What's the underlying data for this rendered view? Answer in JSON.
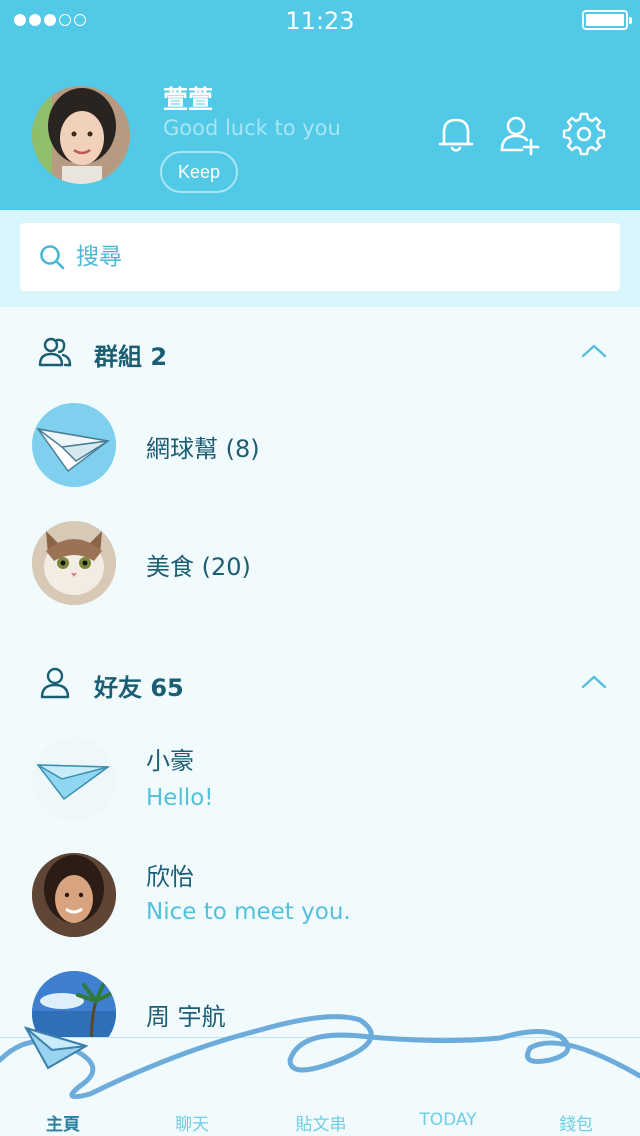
{
  "status_bar": {
    "time": "11:23"
  },
  "profile": {
    "name": "萱萱",
    "status": "Good luck to you",
    "keep_label": "Keep"
  },
  "search": {
    "placeholder": "搜尋"
  },
  "groups": {
    "title": "群組 2",
    "items": [
      {
        "name": "網球幫 (8)",
        "avatar": "paper-plane"
      },
      {
        "name": "美食 (20)",
        "avatar": "cat"
      }
    ]
  },
  "friends": {
    "title": "好友 65",
    "items": [
      {
        "name": "小豪",
        "message": "Hello!",
        "avatar": "paper-plane"
      },
      {
        "name": "欣怡",
        "message": "Nice to meet you.",
        "avatar": "woman"
      },
      {
        "name": "周 宇航",
        "message": "",
        "avatar": "beach"
      }
    ]
  },
  "tabs": [
    {
      "label": "主頁",
      "active": true
    },
    {
      "label": "聊天",
      "active": false
    },
    {
      "label": "貼文串",
      "active": false
    },
    {
      "label": "TODAY",
      "active": false
    },
    {
      "label": "錢包",
      "active": false
    }
  ],
  "colors": {
    "header": "#52c9e6",
    "accent": "#56c0da",
    "text_dark": "#1b5e74"
  }
}
